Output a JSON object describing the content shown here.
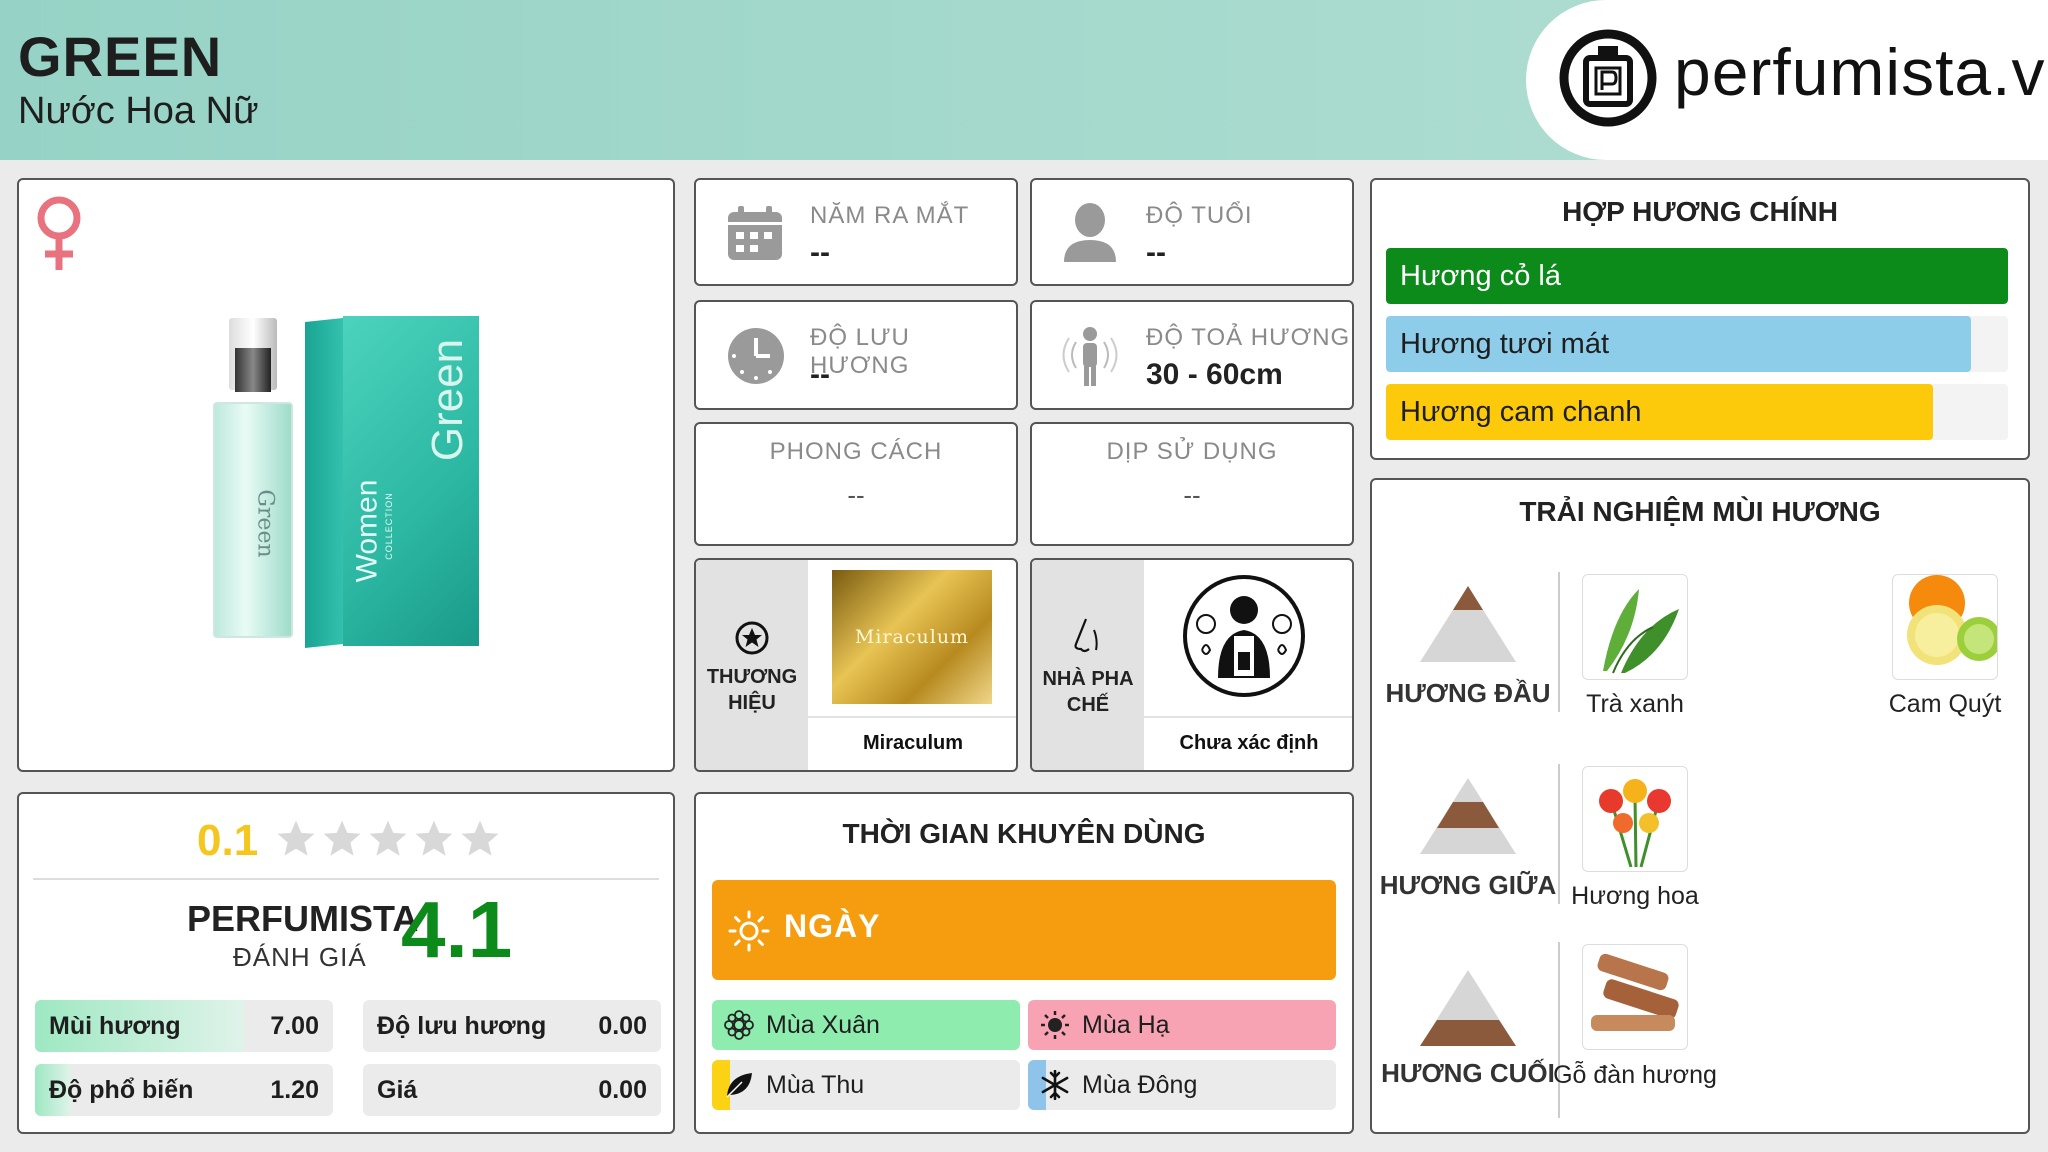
{
  "header": {
    "title": "GREEN",
    "subtitle": "Nước Hoa Nữ",
    "brand_site": "perfumista.vn"
  },
  "product": {
    "gender_icon": "female-symbol-icon",
    "bottle_label": "Green",
    "box_label": "Green",
    "box_side_label": "Women",
    "box_side_small": "COLLECTION"
  },
  "info": {
    "launch_year": {
      "label": "NĂM RA MẮT",
      "value": "--"
    },
    "age": {
      "label": "ĐỘ TUỔI",
      "value": "--"
    },
    "longevity": {
      "label": "ĐỘ LƯU HƯƠNG",
      "value": "--"
    },
    "sillage": {
      "label": "ĐỘ TOẢ HƯƠNG",
      "value": "30 - 60cm"
    },
    "style": {
      "label": "PHONG CÁCH",
      "value": "--"
    },
    "occasion": {
      "label": "DỊP SỬ DỤNG",
      "value": "--"
    }
  },
  "brand": {
    "label": "THƯƠNG HIỆU",
    "name": "Miraculum",
    "logo_text": "Miraculum"
  },
  "perfumer": {
    "label": "NHÀ PHA CHẾ",
    "name": "Chưa xác định"
  },
  "accords": {
    "title": "HỢP HƯƠNG CHÍNH",
    "items": [
      {
        "label": "Hương cỏ lá",
        "pct": 100,
        "color": "#0c8a1a"
      },
      {
        "label": "Hương tươi mát",
        "pct": 94,
        "color": "#8ecdea"
      },
      {
        "label": "Hương cam chanh",
        "pct": 88,
        "color": "#fcca0a"
      }
    ]
  },
  "rating": {
    "user_score": "0.1",
    "stars_filled": 0.02,
    "stars_total": 5,
    "perfumista_label": "PERFUMISTA",
    "perfumista_sub": "ĐÁNH GIÁ",
    "perfumista_score": "4.1",
    "stats": [
      {
        "label": "Mùi hương",
        "value": "7.00",
        "fill": 0.7
      },
      {
        "label": "Độ lưu hương",
        "value": "0.00",
        "fill": 0
      },
      {
        "label": "Độ phổ biến",
        "value": "1.20",
        "fill": 0.12
      },
      {
        "label": "Giá",
        "value": "0.00",
        "fill": 0
      }
    ]
  },
  "usage": {
    "title": "THỜI GIAN KHUYÊN DÙNG",
    "day_label": "NGÀY",
    "day_color": "#f59d0e",
    "seasons": [
      {
        "label": "Mùa Xuân",
        "fill": 1,
        "color": "#8eedae",
        "icon": "flower-icon"
      },
      {
        "label": "Mùa Hạ",
        "fill": 1,
        "color": "#f8a3b3",
        "icon": "sun-icon"
      },
      {
        "label": "Mùa Thu",
        "fill": 0.06,
        "color": "#fcd214",
        "icon": "leaf-icon"
      },
      {
        "label": "Mùa Đông",
        "fill": 0.06,
        "color": "#8ec4ea",
        "icon": "snowflake-icon"
      }
    ]
  },
  "notes": {
    "title": "TRẢI NGHIỆM MÙI HƯƠNG",
    "top": {
      "label": "HƯƠNG ĐẦU",
      "items": [
        "Trà xanh",
        "Cam Quýt"
      ]
    },
    "middle": {
      "label": "HƯƠNG GIỮA",
      "items": [
        "Hương hoa"
      ]
    },
    "base": {
      "label": "HƯƠNG CUỐI",
      "items": [
        "Gỗ đàn hương"
      ]
    }
  }
}
